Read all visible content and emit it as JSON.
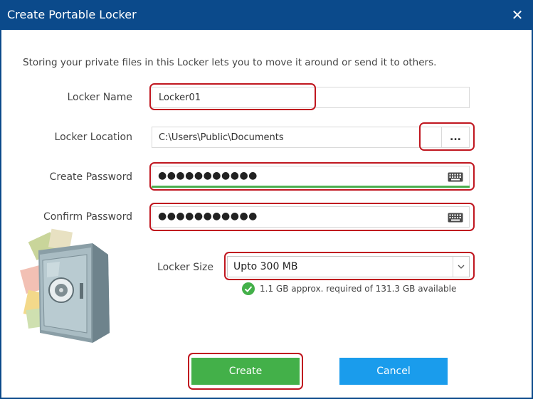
{
  "window": {
    "title": "Create Portable Locker",
    "close_glyph": "✕",
    "title_bar_color": "#0b4a8b"
  },
  "description": "Storing your private files in this Locker lets you to move it around or send it to others.",
  "form": {
    "locker_name": {
      "label": "Locker Name",
      "value": "Locker01"
    },
    "locker_location": {
      "label": "Locker Location",
      "value": "C:\\Users\\Public\\Documents",
      "browse_label": "..."
    },
    "create_password": {
      "label": "Create Password",
      "masked_value": "●●●●●●●●●●●",
      "icon": "keyboard-icon"
    },
    "confirm_password": {
      "label": "Confirm Password",
      "masked_value": "●●●●●●●●●●●",
      "icon": "keyboard-icon"
    },
    "locker_size": {
      "label": "Locker Size",
      "selected": "Upto 300 MB"
    },
    "space_note": "1.1 GB approx. required of 131.3 GB available"
  },
  "buttons": {
    "create": "Create",
    "cancel": "Cancel"
  },
  "illustration": "safe-illustration",
  "colors": {
    "highlight": "#c0161f",
    "create_button": "#43b049",
    "cancel_button": "#1a9cec",
    "password_strength": "#4caf50",
    "check": "#43b049"
  }
}
